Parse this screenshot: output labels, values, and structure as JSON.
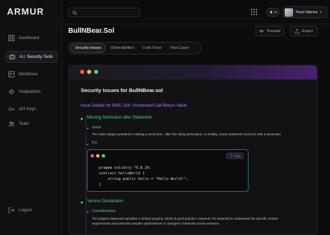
{
  "brand": {
    "logo_text": "ARMUR"
  },
  "sidebar": {
    "items": [
      {
        "label": "Dashboard",
        "icon": "grid-icon"
      },
      {
        "label": "A.I. Security Tools",
        "icon": "robot-icon",
        "active": true
      },
      {
        "label": "Workflows",
        "icon": "workflow-icon"
      },
      {
        "label": "Integrations",
        "icon": "integrations-icon"
      },
      {
        "label": "API Keys",
        "icon": "key-icon"
      },
      {
        "label": "Team",
        "icon": "team-icon"
      }
    ],
    "logout_label": "Logout"
  },
  "topbar": {
    "search_placeholder": "",
    "badge_count": "15",
    "user_name": "Peetz Warrios"
  },
  "main": {
    "title": "BullNBear.Sol",
    "preview_label": "Preview",
    "export_label": "Export",
    "tabs": [
      {
        "label": "Security Issues",
        "active": true
      },
      {
        "label": "Vulnerabilities"
      },
      {
        "label": "Code Fixes"
      },
      {
        "label": "Test Cases"
      }
    ]
  },
  "report": {
    "heading": "Security Issues for BullNBear.sol",
    "detail_title": "Issue Details for SWC-104: Unchecked Call Return Value",
    "items": [
      {
        "title": "Missing Semicolon after Statement",
        "issue_label": "Issue",
        "issue_text": "The code snippet provided is missing a semicolon ; after the string declaration. In Solidity, every statement must end with a semicolon.",
        "fix_label": "Fix"
      },
      {
        "title": "Version Declaration",
        "consideration_label": "Consideration",
        "consideration_text_1": "The pragma statement specifies a version pragma, which is good practice. However, it's essential to understand the specific version",
        "consideration_text_2": "requirements and potential compiler optimizations or changes in behavior across versions."
      }
    ],
    "code": {
      "copy_label": "Copy",
      "lines": [
        "pragma solidity ^0.8.10;",
        "contract helloWorld {",
        "    string public hello = \"Hello World!\";",
        "}"
      ]
    }
  },
  "colors": {
    "accent_purple": "#b978ff",
    "accent_green": "#4ed08a",
    "background": "#0c0c0e"
  }
}
